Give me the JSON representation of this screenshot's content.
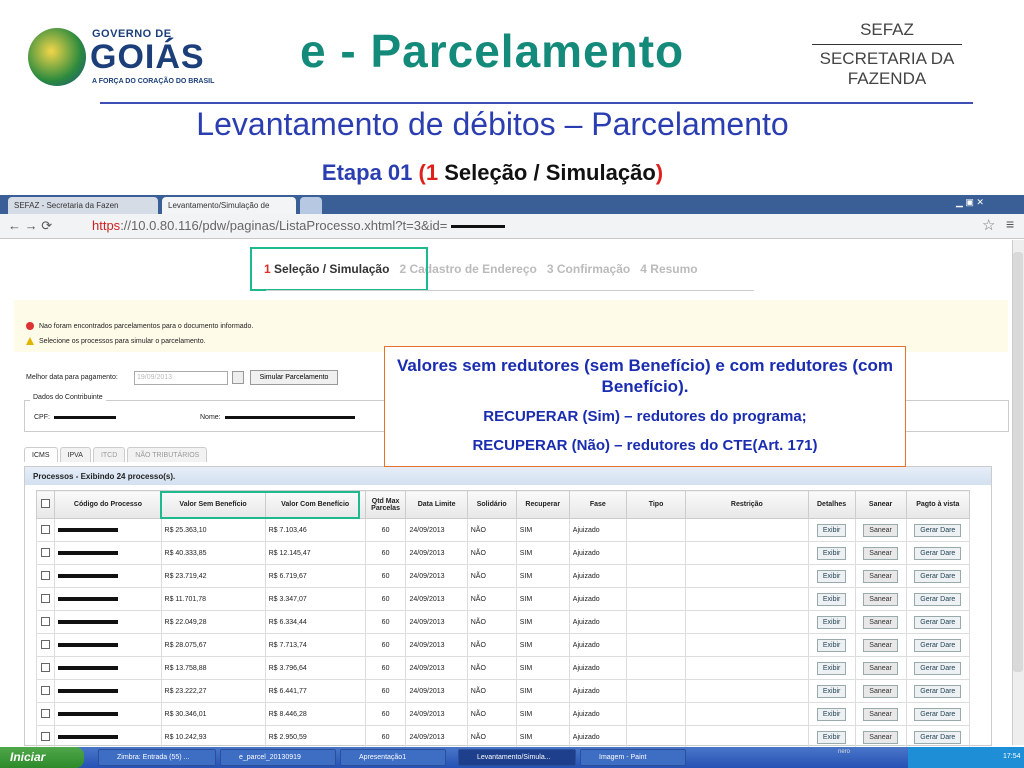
{
  "header": {
    "logo_small": "GOVERNO DE",
    "logo_big": "GOIÁS",
    "logo_tagline": "A FORÇA DO CORAÇÃO DO BRASIL",
    "title": "e - Parcelamento",
    "sefaz_line1": "SEFAZ",
    "sefaz_line2": "SECRETARIA DA",
    "sefaz_line3": "FAZENDA"
  },
  "subtitle": "Levantamento de débitos – Parcelamento",
  "etapa": {
    "prefix": "Etapa 01 ",
    "open": "(",
    "num": "1",
    "label": " Seleção / Simulação",
    "close": ")"
  },
  "browser": {
    "tabs": [
      "SEFAZ - Secretaria da Fazen",
      "Levantamento/Simulação de"
    ],
    "url_prefix": "https",
    "url_rest": "://10.0.80.116/pdw/paginas/ListaProcesso.xhtml?t=3&id="
  },
  "steps": {
    "s1_num": "1",
    "s1": "Seleção / Simulação",
    "s2_num": "2",
    "s2": "Cadastro de Endereço",
    "s3_num": "3",
    "s3": "Confirmação",
    "s4_num": "4",
    "s4": "Resumo"
  },
  "messages": {
    "error": "Nao foram encontrados parcelamentos para o documento informado.",
    "warning": "Selecione os processos para simular o parcelamento."
  },
  "form": {
    "best_date_label": "Melhor data para pagamento:",
    "best_date_value": "19/09/2013",
    "simulate_btn": "Simular Parcelamento",
    "contrib_legend": "Dados do Contribuinte",
    "cpf_label": "CPF:",
    "nome_label": "Nome:"
  },
  "inner_tabs": [
    "ICMS",
    "IPVA",
    "ITCD",
    "NÃO TRIBUTÁRIOS"
  ],
  "callout": {
    "line1": "Valores sem redutores (sem Benefício) e com redutores (com Benefício).",
    "line2": "RECUPERAR (Sim) – redutores do programa;",
    "line3": "RECUPERAR (Não) – redutores do CTE(Art. 171)"
  },
  "processes": {
    "header": "Processos - Exibindo 24 processo(s).",
    "columns": [
      "Código do Processo",
      "Valor Sem Benefício",
      "Valor Com Benefício",
      "Qtd Max Parcelas",
      "Data Limite",
      "Solidário",
      "Recuperar",
      "Fase",
      "Tipo",
      "Restrição",
      "Detalhes",
      "Sanear",
      "Pagto à vista"
    ],
    "buttons": {
      "exibir": "Exibir",
      "sanear": "Sanear",
      "gerar": "Gerar Dare"
    },
    "rows": [
      {
        "sem": "R$ 25.363,10",
        "com": "R$ 7.103,46",
        "qtd": "60",
        "data": "24/09/2013",
        "sol": "NÃO",
        "rec": "SIM",
        "fase": "Ajuizado"
      },
      {
        "sem": "R$ 40.333,85",
        "com": "R$ 12.145,47",
        "qtd": "60",
        "data": "24/09/2013",
        "sol": "NÃO",
        "rec": "SIM",
        "fase": "Ajuizado"
      },
      {
        "sem": "R$ 23.719,42",
        "com": "R$ 6.719,67",
        "qtd": "60",
        "data": "24/09/2013",
        "sol": "NÃO",
        "rec": "SIM",
        "fase": "Ajuizado"
      },
      {
        "sem": "R$ 11.701,78",
        "com": "R$ 3.347,07",
        "qtd": "60",
        "data": "24/09/2013",
        "sol": "NÃO",
        "rec": "SIM",
        "fase": "Ajuizado"
      },
      {
        "sem": "R$ 22.049,28",
        "com": "R$ 6.334,44",
        "qtd": "60",
        "data": "24/09/2013",
        "sol": "NÃO",
        "rec": "SIM",
        "fase": "Ajuizado"
      },
      {
        "sem": "R$ 28.075,67",
        "com": "R$ 7.713,74",
        "qtd": "60",
        "data": "24/09/2013",
        "sol": "NÃO",
        "rec": "SIM",
        "fase": "Ajuizado"
      },
      {
        "sem": "R$ 13.758,88",
        "com": "R$ 3.796,64",
        "qtd": "60",
        "data": "24/09/2013",
        "sol": "NÃO",
        "rec": "SIM",
        "fase": "Ajuizado"
      },
      {
        "sem": "R$ 23.222,27",
        "com": "R$ 6.441,77",
        "qtd": "60",
        "data": "24/09/2013",
        "sol": "NÃO",
        "rec": "SIM",
        "fase": "Ajuizado"
      },
      {
        "sem": "R$ 30.346,01",
        "com": "R$ 8.446,28",
        "qtd": "60",
        "data": "24/09/2013",
        "sol": "NÃO",
        "rec": "SIM",
        "fase": "Ajuizado"
      },
      {
        "sem": "R$ 10.242,93",
        "com": "R$ 2.950,59",
        "qtd": "60",
        "data": "24/09/2013",
        "sol": "NÃO",
        "rec": "SIM",
        "fase": "Ajuizado"
      }
    ]
  },
  "taskbar": {
    "start": "Iniciar",
    "items": [
      "Zimbra: Entrada (55) ...",
      "e_parcel_20130919",
      "Apresentação1",
      "Levantamento/Simula...",
      "Imagem - Paint"
    ],
    "nero": "nero",
    "clock": "17:54"
  }
}
